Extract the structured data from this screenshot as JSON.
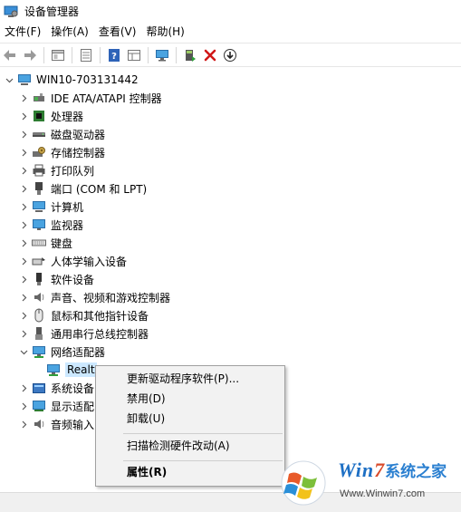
{
  "window": {
    "title": "设备管理器"
  },
  "menubar": {
    "items": [
      "文件(F)",
      "操作(A)",
      "查看(V)",
      "帮助(H)"
    ]
  },
  "toolbar": {
    "icons": [
      "back-icon",
      "forward-icon",
      "properties-view-icon",
      "details-icon",
      "help-icon",
      "grid-icon",
      "monitor-scan-icon",
      "update-driver-icon",
      "uninstall-icon",
      "download-icon"
    ]
  },
  "tree": {
    "root": "WIN10-703131442",
    "items": [
      "IDE ATA/ATAPI 控制器",
      "处理器",
      "磁盘驱动器",
      "存储控制器",
      "打印队列",
      "端口 (COM 和 LPT)",
      "计算机",
      "监视器",
      "键盘",
      "人体学输入设备",
      "软件设备",
      "声音、视频和游戏控制器",
      "鼠标和其他指针设备",
      "通用串行总线控制器",
      "网络适配器",
      "Realt",
      "系统设备",
      "显示适配",
      "音频输入"
    ]
  },
  "context_menu": {
    "items": [
      "更新驱动程序软件(P)...",
      "禁用(D)",
      "卸载(U)",
      "扫描检测硬件改动(A)",
      "属性(R)"
    ]
  },
  "watermark": {
    "brand": "Win",
    "brand_num": "7",
    "brand_suffix": "系统之家",
    "url": "Www.Winwin7.com"
  },
  "colors": {
    "selection": "#cce8ff",
    "menu_bg": "#f2f2f2",
    "accent": "#1d6fc4"
  }
}
